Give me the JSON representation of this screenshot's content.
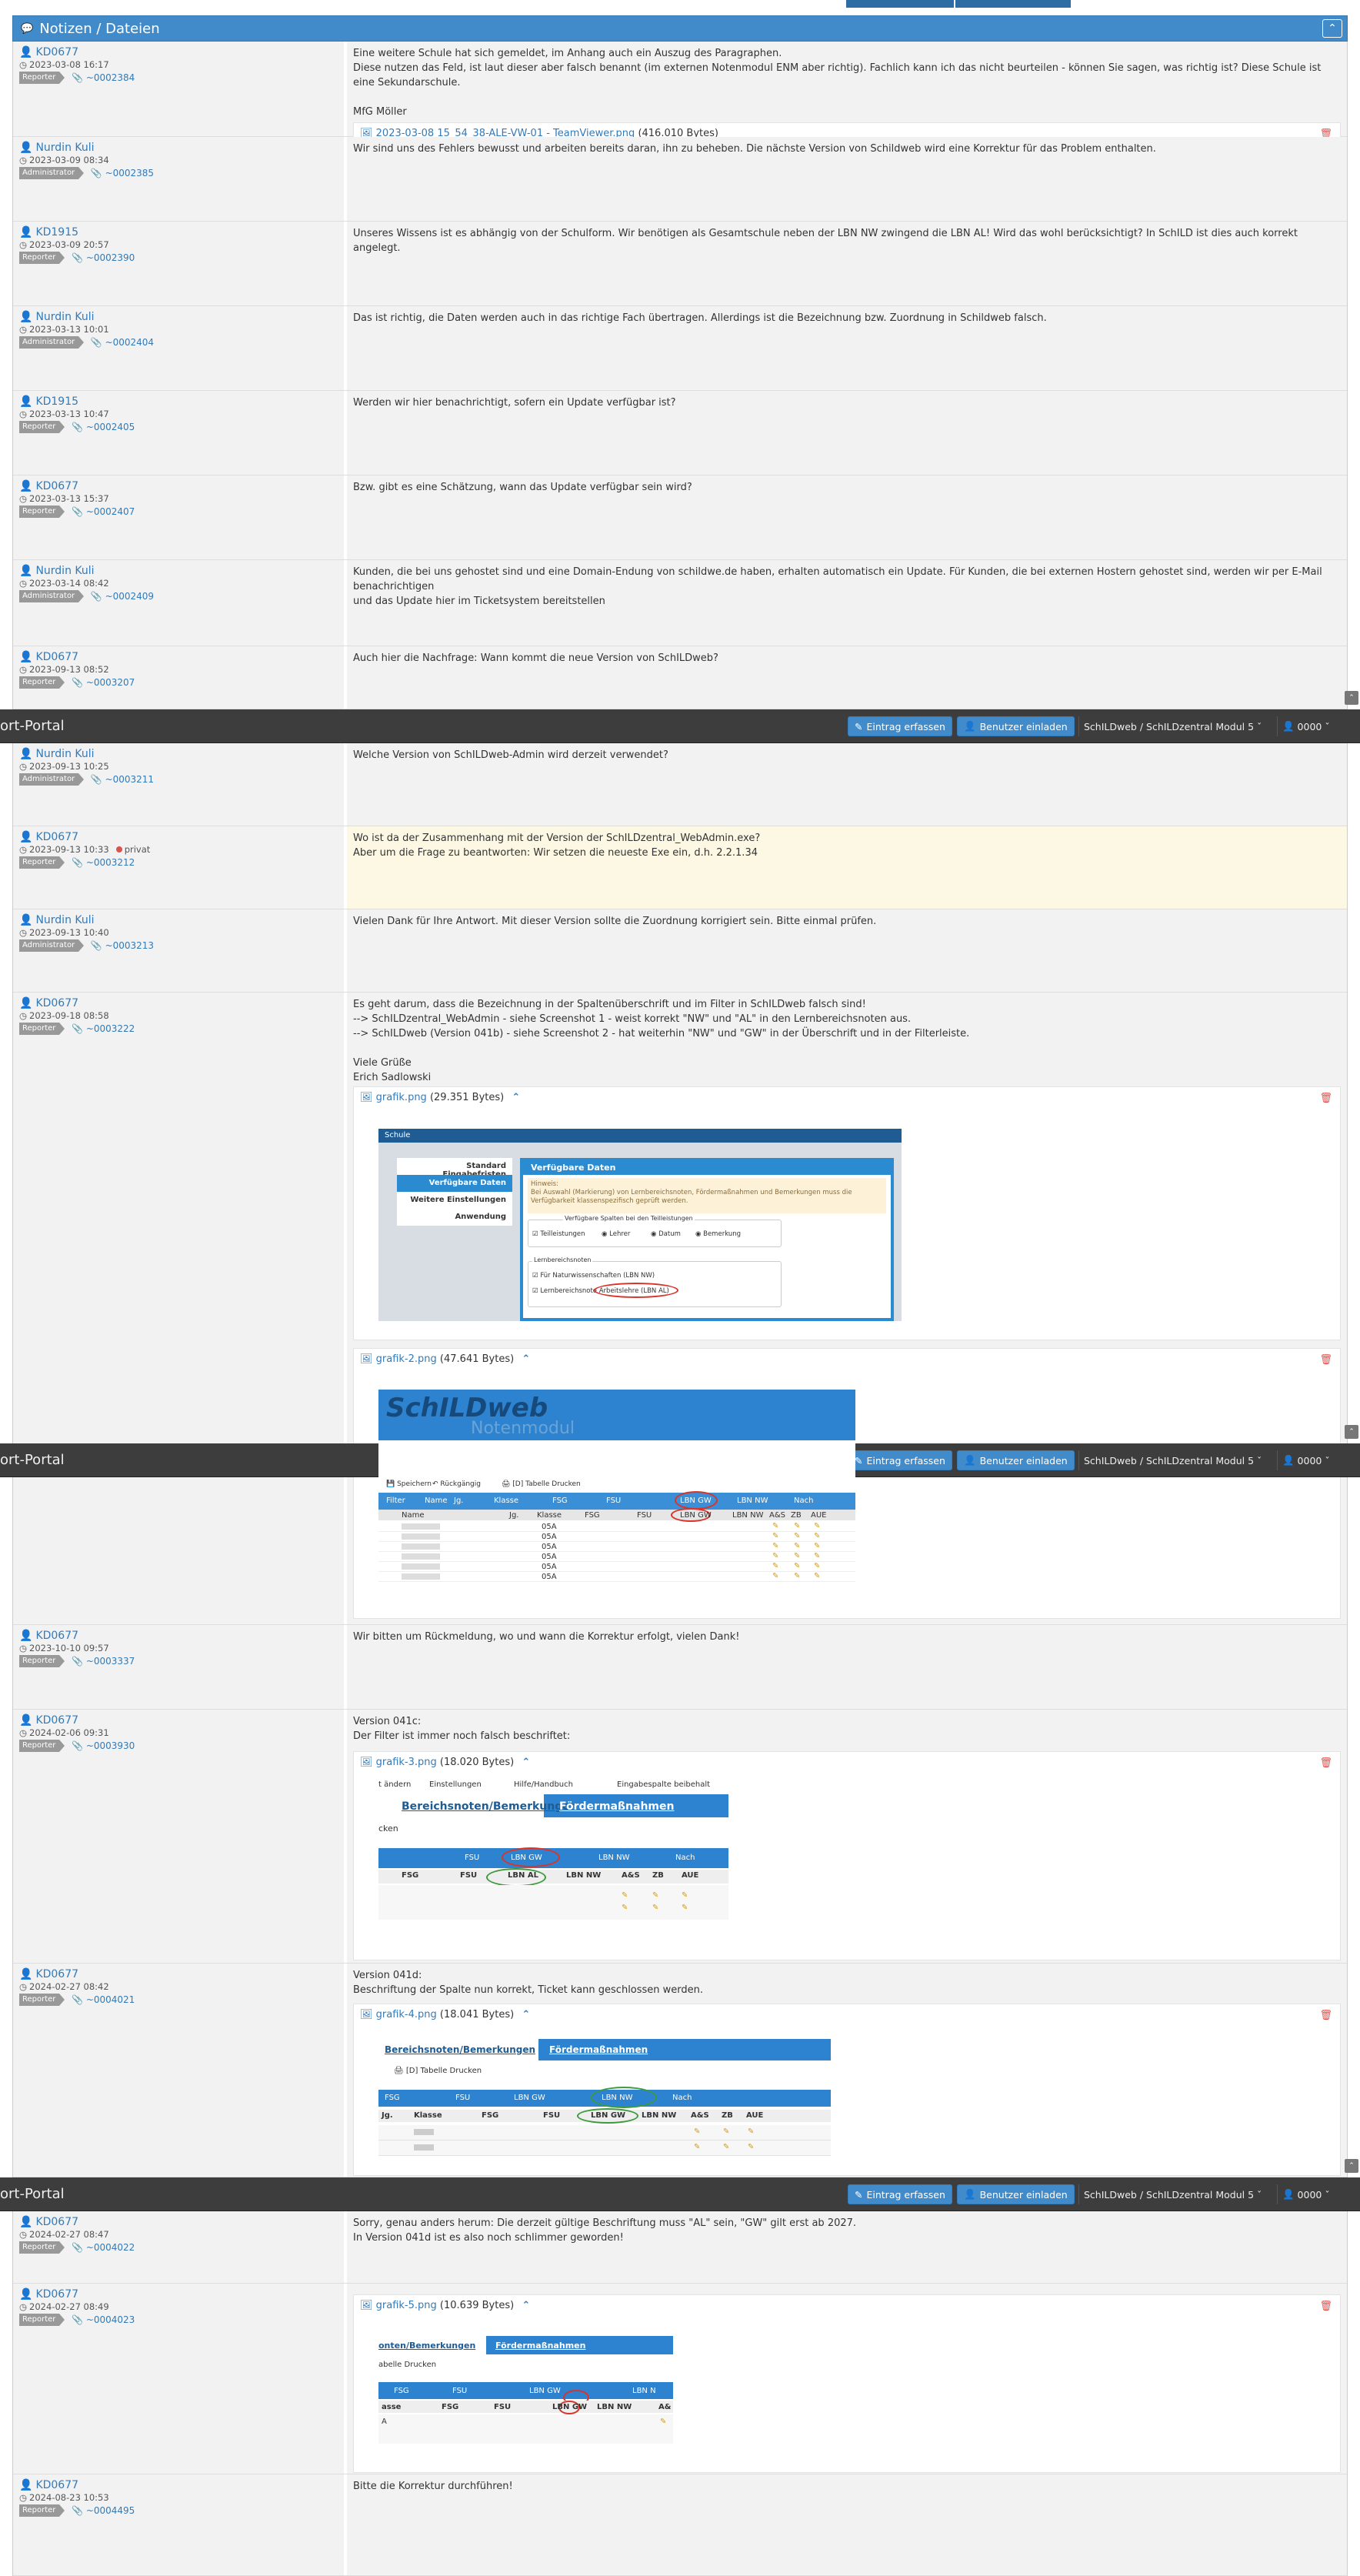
{
  "panel": {
    "title": "Notizen / Dateien",
    "collapse_icon": "chevron-up-icon"
  },
  "navbar": {
    "brand": "ort-Portal",
    "entry_button": "Eintrag erfassen",
    "invite_button": "Benutzer einladen",
    "project_select": "SchILDweb / SchILDzentral Modul 5",
    "user_select": "0000"
  },
  "notes": [
    {
      "reporter": "KD0677",
      "date": "2023-03-08 16:17",
      "role": "Reporter",
      "link": "~0002384",
      "text": [
        "Eine weitere Schule hat sich gemeldet, im Anhang auch ein Auszug des Paragraphen.",
        "Diese nutzen das Feld, ist laut dieser aber falsch benannt (im externen Notenmodul ENM aber richtig). Fachlich kann ich das nicht beurteilen - können Sie sagen, was richtig ist? Diese Schule ist eine Sekundarschule.",
        "",
        "MfG Möller"
      ],
      "attachment": {
        "file": "2023-03-08 15_54_38-ALE-VW-01 - TeamViewer.png",
        "size": "(416.010 Bytes)"
      }
    },
    {
      "reporter": "Nurdin Kuli",
      "date": "2023-03-09 08:34",
      "role": "Administrator",
      "link": "~0002385",
      "text": [
        "Wir sind uns des Fehlers bewusst und arbeiten bereits daran, ihn zu beheben. Die nächste Version von Schildweb wird eine Korrektur für das Problem enthalten."
      ]
    },
    {
      "reporter": "KD1915",
      "date": "2023-03-09 20:57",
      "role": "Reporter",
      "link": "~0002390",
      "text": [
        "Unseres Wissens ist es abhängig von der Schulform. Wir benötigen als Gesamtschule neben der LBN NW zwingend die LBN AL! Wird das wohl berücksichtigt? In SchILD ist dies auch korrekt angelegt."
      ]
    },
    {
      "reporter": "Nurdin Kuli",
      "date": "2023-03-13 10:01",
      "role": "Administrator",
      "link": "~0002404",
      "text": [
        "Das ist richtig, die Daten werden auch in das richtige Fach übertragen. Allerdings ist die Bezeichnung bzw. Zuordnung in Schildweb falsch."
      ]
    },
    {
      "reporter": "KD1915",
      "date": "2023-03-13 10:47",
      "role": "Reporter",
      "link": "~0002405",
      "text": [
        "Werden wir hier benachrichtigt, sofern ein Update verfügbar ist?"
      ]
    },
    {
      "reporter": "KD0677",
      "date": "2023-03-13 15:37",
      "role": "Reporter",
      "link": "~0002407",
      "text": [
        "Bzw. gibt es eine Schätzung, wann das Update verfügbar sein wird?"
      ]
    },
    {
      "reporter": "Nurdin Kuli",
      "date": "2023-03-14 08:42",
      "role": "Administrator",
      "link": "~0002409",
      "text": [
        "Kunden, die bei uns gehostet sind und eine Domain-Endung von schildwe.de haben, erhalten automatisch ein Update. Für Kunden, die bei externen Hostern gehostet sind, werden wir per E-Mail benachrichtigen",
        "und das Update hier im Ticketsystem bereitstellen"
      ]
    },
    {
      "reporter": "KD0677",
      "date": "2023-09-13 08:52",
      "role": "Reporter",
      "link": "~0003207",
      "text": [
        "Auch hier die Nachfrage: Wann kommt die neue Version von SchILDweb?"
      ]
    },
    {
      "reporter": "Nurdin Kuli",
      "date": "2023-09-13 10:25",
      "role": "Administrator",
      "link": "~0003211",
      "text": [
        "Welche Version von SchILDweb-Admin wird derzeit verwendet?"
      ]
    },
    {
      "reporter": "KD0677",
      "date": "2023-09-13 10:33",
      "role": "Reporter",
      "link": "~0003212",
      "private": "privat",
      "text": [
        "Wo ist da der Zusammenhang mit der Version der SchILDzentral_WebAdmin.exe?",
        "Aber um die Frage zu beantworten: Wir setzen die neueste Exe ein, d.h. 2.2.1.34"
      ]
    },
    {
      "reporter": "Nurdin Kuli",
      "date": "2023-09-13 10:40",
      "role": "Administrator",
      "link": "~0003213",
      "text": [
        "Vielen Dank für Ihre Antwort. Mit dieser Version sollte die Zuordnung korrigiert sein. Bitte einmal prüfen."
      ]
    },
    {
      "reporter": "KD0677",
      "date": "2023-09-18 08:58",
      "role": "Reporter",
      "link": "~0003222",
      "text": [
        "Es geht darum, dass die Bezeichnung in der Spaltenüberschrift und im Filter in SchILDweb falsch sind!",
        "--> SchILDzentral_WebAdmin - siehe Screenshot 1 - weist korrekt \"NW\" und \"AL\" in den Lernbereichsnoten aus.",
        "--> SchILDweb (Version 041b) - siehe Screenshot 2 - hat weiterhin \"NW\" und \"GW\" in der Überschrift und in der Filterleiste.",
        "",
        "Viele Grüße",
        "Erich Sadlowski"
      ],
      "attachments": [
        {
          "file": "grafik.png",
          "size": "(29.351 Bytes)"
        },
        {
          "file": "grafik-2.png",
          "size": "(47.641 Bytes)"
        }
      ]
    },
    {
      "reporter": "KD0677",
      "date": "2023-10-10 09:57",
      "role": "Reporter",
      "link": "~0003337",
      "text": [
        "Wir bitten um Rückmeldung, wo und wann die Korrektur erfolgt, vielen Dank!"
      ]
    },
    {
      "reporter": "KD0677",
      "date": "2024-02-06 09:31",
      "role": "Reporter",
      "link": "~0003930",
      "text": [
        "Version 041c:",
        "Der Filter ist immer noch falsch beschriftet:"
      ],
      "attachment": {
        "file": "grafik-3.png",
        "size": "(18.020 Bytes)"
      }
    },
    {
      "reporter": "KD0677",
      "date": "2024-02-27 08:42",
      "role": "Reporter",
      "link": "~0004021",
      "text": [
        "Version 041d:",
        "Beschriftung der Spalte nun korrekt, Ticket kann geschlossen werden."
      ],
      "attachment": {
        "file": "grafik-4.png",
        "size": "(18.041 Bytes)"
      }
    },
    {
      "reporter": "KD0677",
      "date": "2024-02-27 08:47",
      "role": "Reporter",
      "link": "~0004022",
      "text": [
        "Sorry, genau anders herum: Die derzeit gültige Beschriftung muss \"AL\" sein, \"GW\" gilt erst ab 2027.",
        "In Version 041d ist es also noch schlimmer geworden!"
      ]
    },
    {
      "reporter": "KD0677",
      "date": "2024-02-27 08:49",
      "role": "Reporter",
      "link": "~0004023",
      "text": [],
      "attachment": {
        "file": "grafik-5.png",
        "size": "(10.639 Bytes)"
      }
    },
    {
      "reporter": "KD0677",
      "date": "2024-08-23 10:53",
      "role": "Reporter",
      "link": "~0004495",
      "text": [
        "Bitte die Korrektur durchführen!"
      ]
    }
  ],
  "shot1": {
    "header": "Schule",
    "menu": [
      "Standard Eingabefristen",
      "Verfügbare Daten",
      "Weitere Einstellungen",
      "Anwendung"
    ],
    "panel_title": "Verfügbare Daten",
    "hint_title": "Hinweis:",
    "hint": "Bei Auswahl (Markierung) von Lernbereichsnoten, Fördermaßnahmen und Bemerkungen muss die Verfügbarkeit klassenspezifisch geprüft werden.",
    "group": "Verfügbare Spalten bei den Teilleistungen",
    "checks": [
      "Teilleistungen",
      "Lehrer",
      "Datum",
      "Bemerkung"
    ],
    "lb_title": "Lernbereichsnoten",
    "lb1": "Für Naturwissenschaften (LBN NW)",
    "lb2": "Lernbereichsnote Arbeitslehre (LBN AL)"
  },
  "shot2": {
    "logo": "SchILDweb",
    "sub": "Notenmodul",
    "toolbar": [
      "Speichern",
      "Rückgängig",
      "[D] Tabelle Drucken"
    ],
    "filter": [
      "Filter",
      "Name",
      "Jg.",
      "Klasse",
      "FSG",
      "FSU",
      "LBN GW",
      "LBN NW",
      "Nach"
    ],
    "cols": [
      "Name",
      "Jg.",
      "Klasse",
      "FSG",
      "FSU",
      "LBN GW",
      "LBN NW",
      "A&S",
      "ZB",
      "AUE"
    ],
    "klasse": "05A"
  },
  "shot3": {
    "toolbar": [
      "t ändern",
      "Einstellungen",
      "Hilfe/Handbuch",
      "Eingabespalte beibehalt"
    ],
    "tabs": [
      "Bereichsnoten/Bemerkungen",
      "Fördermaßnahmen"
    ],
    "sub": "cken",
    "filter": [
      "FSU",
      "LBN GW",
      "LBN NW",
      "Nach"
    ],
    "cols": [
      "FSG",
      "FSU",
      "LBN AL",
      "LBN NW",
      "A&S",
      "ZB",
      "AUE"
    ]
  },
  "shot4": {
    "tabs": [
      "Bereichsnoten/Bemerkungen",
      "Fördermaßnahmen"
    ],
    "sub": "[D] Tabelle Drucken",
    "filter": [
      "FSG",
      "FSU",
      "LBN GW",
      "LBN NW",
      "Nach"
    ],
    "cols": [
      "Jg.",
      "Klasse",
      "FSG",
      "FSU",
      "LBN GW",
      "LBN NW",
      "A&S",
      "ZB",
      "AUE"
    ]
  },
  "shot5": {
    "tabs": [
      "onten/Bemerkungen",
      "Fördermaßnahmen"
    ],
    "sub": "abelle Drucken",
    "filter": [
      "FSG",
      "FSU",
      "LBN GW",
      "LBN N"
    ],
    "cols": [
      "asse",
      "FSG",
      "FSU",
      "LBN GW",
      "LBN NW",
      "A&"
    ],
    "row": "A"
  },
  "icons": {
    "user": "user-icon",
    "clock": "clock-icon",
    "paperclip": "paperclip-icon",
    "file": "file-image-icon",
    "trash": "trash-icon",
    "comments": "comments-icon"
  },
  "colors": {
    "accent": "#428bca",
    "navbar": "#3d3d3d",
    "private_bg": "#fcf8e3"
  }
}
